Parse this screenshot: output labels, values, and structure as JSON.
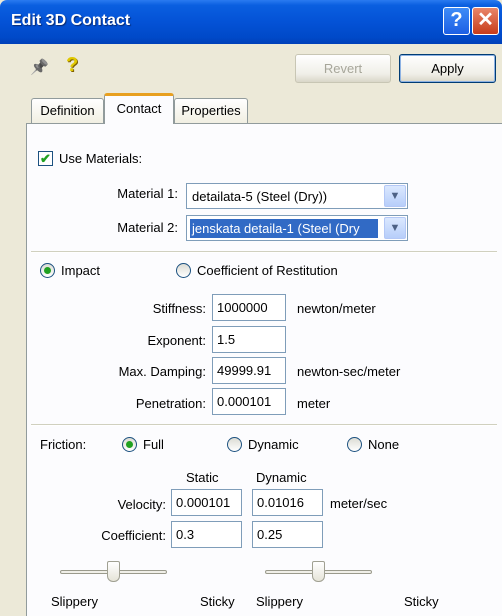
{
  "window": {
    "title": "Edit 3D Contact",
    "help_glyph": "?",
    "close_glyph": "✕"
  },
  "toolbar": {
    "revert_label": "Revert",
    "apply_label": "Apply",
    "pin_glyph": "📌",
    "help_glyph": "?"
  },
  "tabs": [
    {
      "label": "Definition",
      "active": false
    },
    {
      "label": "Contact",
      "active": true
    },
    {
      "label": "Properties",
      "active": false
    }
  ],
  "materials": {
    "use_label": "Use Materials:",
    "use_checked": true,
    "material1_label": "Material 1:",
    "material1_value": "detailata-5 (Steel (Dry))",
    "material2_label": "Material 2:",
    "material2_value": "jenskata detaila-1 (Steel (Dry"
  },
  "model": {
    "impact_label": "Impact",
    "restitution_label": "Coefficient of Restitution",
    "selected": "Impact",
    "stiffness_label": "Stiffness:",
    "stiffness_value": "1000000",
    "stiffness_unit": "newton/meter",
    "exponent_label": "Exponent:",
    "exponent_value": "1.5",
    "damping_label": "Max. Damping:",
    "damping_value": "49999.91",
    "damping_unit": "newton-sec/meter",
    "penetration_label": "Penetration:",
    "penetration_value": "0.000101",
    "penetration_unit": "meter"
  },
  "friction": {
    "label": "Friction:",
    "full_label": "Full",
    "dynamic_label": "Dynamic",
    "none_label": "None",
    "selected": "Full",
    "static_header": "Static",
    "dynamic_header": "Dynamic",
    "velocity_label": "Velocity:",
    "static_velocity": "0.000101",
    "dynamic_velocity": "0.01016",
    "velocity_unit": "meter/sec",
    "coefficient_label": "Coefficient:",
    "static_coefficient": "0.3",
    "dynamic_coefficient": "0.25",
    "slippery_label": "Slippery",
    "sticky_label": "Sticky",
    "static_slider_position": 0.5,
    "dynamic_slider_position": 0.5
  },
  "colors": {
    "title_bar": "#0452d6",
    "selection": "#316ac5",
    "check_green": "#21a121",
    "tab_accent": "#e8a020"
  }
}
